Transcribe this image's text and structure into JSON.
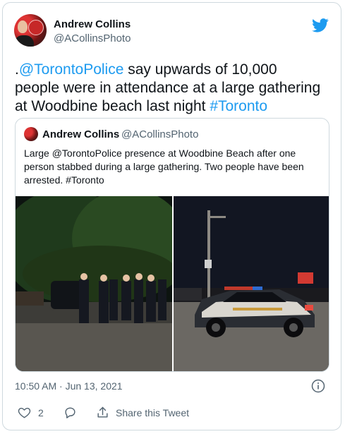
{
  "tweet": {
    "author_name": "Andrew Collins",
    "author_handle": "@ACollinsPhoto",
    "text_prefix": ".",
    "mention": "@TorontoPolice",
    "text_body": " say upwards of 10,000 people were in attendance at a large gathering at Woodbine beach last night ",
    "hashtag": "#Toronto",
    "timestamp": "10:50 AM · Jun 13, 2021",
    "like_count": "2",
    "share_label": "Share this Tweet"
  },
  "quoted_tweet": {
    "author_name": "Andrew Collins",
    "author_handle": "@ACollinsPhoto",
    "text": "Large @TorontoPolice presence at Woodbine Beach after one person stabbed during a large gathering. Two people have been arrested. #Toronto"
  },
  "icons": {
    "brand": "twitter-bird-icon",
    "info": "info-icon",
    "like": "heart-icon",
    "reply": "reply-icon",
    "share": "share-icon"
  },
  "colors": {
    "accent": "#1d9bf0",
    "text": "#0f1419",
    "secondary_text": "#536471",
    "border": "#cfd9de"
  }
}
